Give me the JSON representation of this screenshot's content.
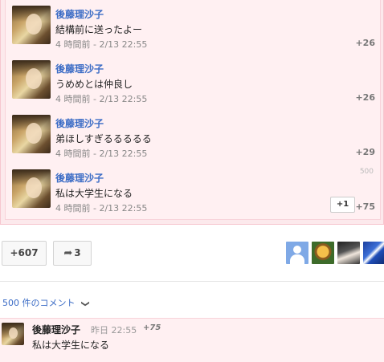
{
  "comments": [
    {
      "author": "後藤理沙子",
      "text": "結構前に送ったよー",
      "meta": "4 時間前 - 2/13 22:55",
      "score": "+26"
    },
    {
      "author": "後藤理沙子",
      "text": "うめめとは仲良し",
      "meta": "4 時間前 - 2/13 22:55",
      "score": "+26"
    },
    {
      "author": "後藤理沙子",
      "text": "弟ほしすぎるるるるる",
      "meta": "4 時間前 - 2/13 22:55",
      "score": "+29"
    },
    {
      "author": "後藤理沙子",
      "text": "私は大学生になる",
      "meta": "4 時間前 - 2/13 22:55",
      "score": "+75",
      "count": "500",
      "plusone_label": "+1"
    }
  ],
  "actions": {
    "plus_label": "+607",
    "share_count": "3"
  },
  "sharers": [
    "default-avatar-icon",
    "sunflower-avatar",
    "photo-avatar",
    "blue-photo-avatar"
  ],
  "comments_link": "500 件のコメント",
  "bottom_comment": {
    "author": "後藤理沙子",
    "time": "昨日 22:55",
    "score": "+75",
    "text": "私は大学生になる"
  }
}
